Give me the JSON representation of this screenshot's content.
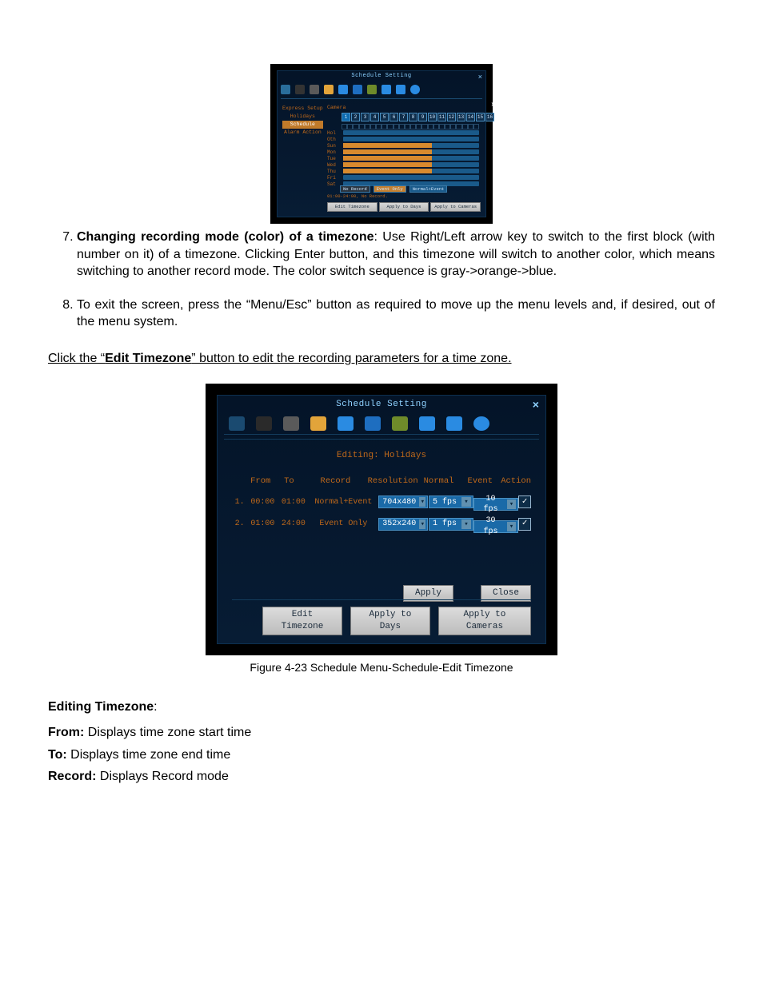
{
  "list": {
    "item7": {
      "lead": "Changing recording mode (color) of a timezone",
      "text": ": Use Right/Left arrow key to switch to the first block (with number on it) of a timezone. Clicking Enter button, and this timezone will switch to another color, which means switching to another record mode. The color switch sequence is gray->orange->blue."
    },
    "item8": "To exit the screen, press the “Menu/Esc” button as required to move up the menu levels and, if desired, out of the menu system."
  },
  "clickline": {
    "pre": "Click the “",
    "btn": "Edit Timezone",
    "post": "” button to edit the recording parameters for a time zone."
  },
  "fig_small": {
    "title": "Schedule Setting",
    "nav": [
      "Express Setup",
      "Holidays",
      "Schedule",
      "Alarm Action"
    ],
    "camera_label": "Camera",
    "days": [
      "Hol",
      "Oth",
      "Sun",
      "Mon",
      "Tue",
      "Wed",
      "Thu",
      "Fri",
      "Sat"
    ],
    "legend": {
      "no": "No Record",
      "evt": "Event Only",
      "ne": "Normal+Event"
    },
    "note": "01:00-24:00, No Record.",
    "btns": {
      "edit": "Edit Timezone",
      "days": "Apply to Days",
      "cams": "Apply to Cameras"
    }
  },
  "fig_big": {
    "title": "Schedule Setting",
    "editing": "Editing: Holidays",
    "hdr": {
      "from": "From",
      "to": "To",
      "rec": "Record",
      "res": "Resolution",
      "norm": "Normal",
      "evt": "Event",
      "act": "Action"
    },
    "rows": [
      {
        "idx": "1.",
        "from": "00:00",
        "to": "01:00",
        "rec": "Normal+Event",
        "res": "704x480",
        "norm": "5 fps",
        "evt": "10 fps"
      },
      {
        "idx": "2.",
        "from": "01:00",
        "to": "24:00",
        "rec": "Event Only",
        "res": "352x240",
        "norm": "1 fps",
        "evt": "30 fps"
      }
    ],
    "apply": "Apply",
    "close": "Close",
    "footer": {
      "edit": "Edit Timezone",
      "days": "Apply to Days",
      "cams": "Apply to Cameras"
    }
  },
  "caption": "Figure 4-23 Schedule Menu-Schedule-Edit Timezone",
  "defs": {
    "heading": "Editing Timezone",
    "from_lbl": "From:",
    "from_txt": " Displays time zone start time",
    "to_lbl": "To:",
    "to_txt": " Displays time zone end time",
    "rec_lbl": "Record:",
    "rec_txt": " Displays Record mode"
  }
}
